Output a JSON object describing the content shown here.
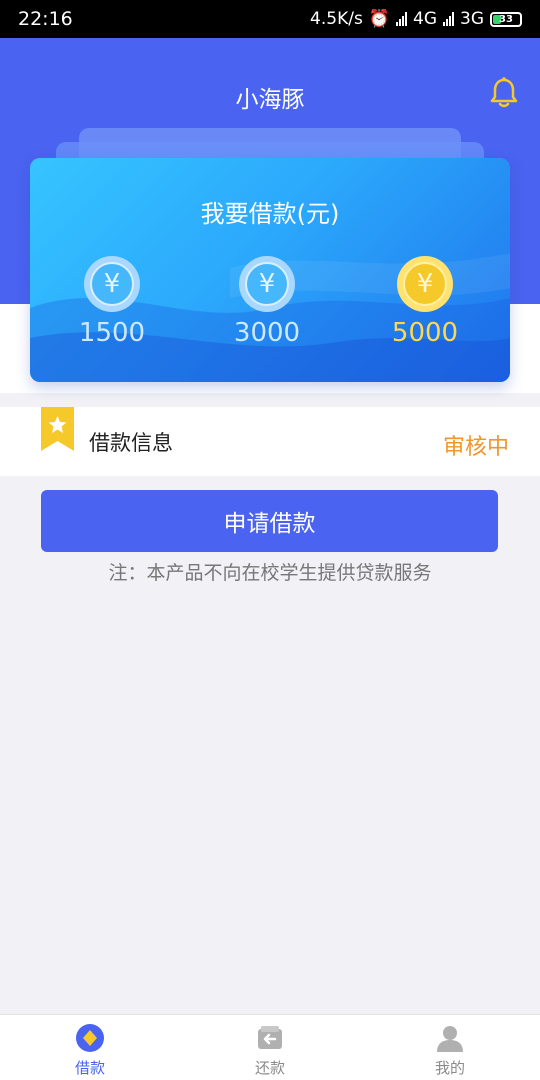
{
  "status_bar": {
    "time": "22:16",
    "speed": "4.5K/s",
    "network1": "4G",
    "network2": "3G",
    "battery": "33"
  },
  "header": {
    "title": "小海豚"
  },
  "card": {
    "title": "我要借款(元)",
    "currency_symbol": "¥",
    "amounts": [
      {
        "value": "1500",
        "selected": false
      },
      {
        "value": "3000",
        "selected": false
      },
      {
        "value": "5000",
        "selected": true
      }
    ]
  },
  "loan_info": {
    "label": "借款信息",
    "status": "审核中"
  },
  "apply_button": {
    "label": "申请借款"
  },
  "note": "注：本产品不向在校学生提供贷款服务",
  "tabbar": {
    "items": [
      {
        "label": "借款",
        "icon": "borrow-icon",
        "active": true
      },
      {
        "label": "还款",
        "icon": "repay-icon",
        "active": false
      },
      {
        "label": "我的",
        "icon": "profile-icon",
        "active": false
      }
    ]
  },
  "colors": {
    "primary": "#4a63f0",
    "accent_gold": "#ffd84d",
    "status_orange": "#f0962a"
  }
}
